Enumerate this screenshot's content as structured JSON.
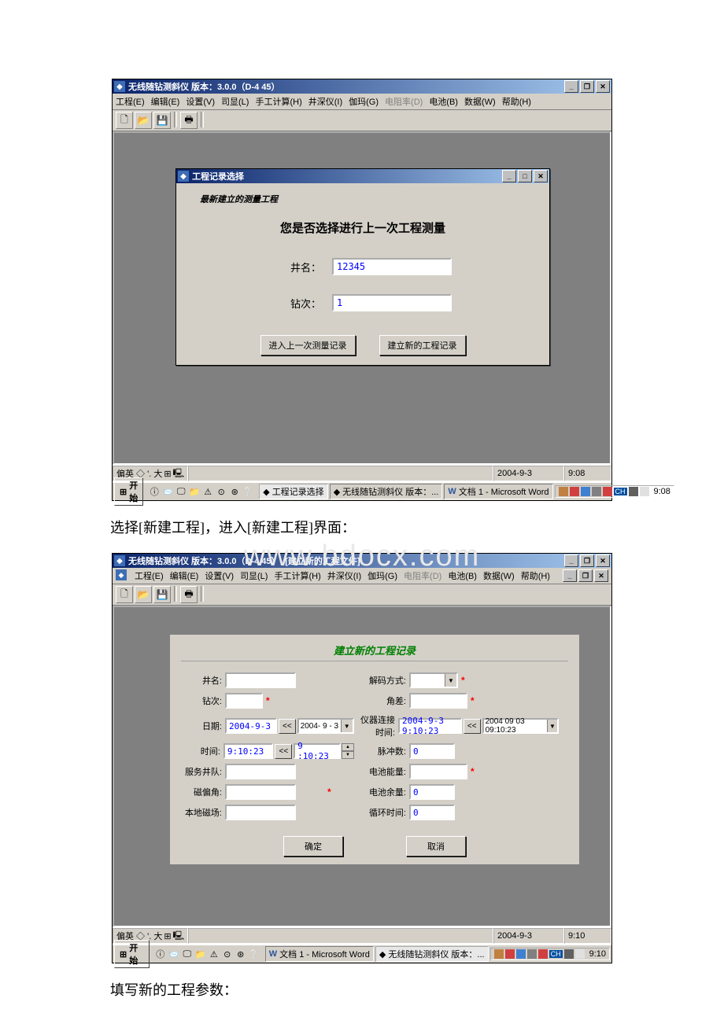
{
  "watermark": "www.bdocx.com",
  "screenshot1": {
    "title": "无线随钻测斜仪 版本：3.0.0（D-4 45）",
    "menubar": [
      {
        "label": "工程(E)",
        "disabled": false
      },
      {
        "label": "编辑(E)",
        "disabled": false
      },
      {
        "label": "设置(V)",
        "disabled": false
      },
      {
        "label": "司显(L)",
        "disabled": false
      },
      {
        "label": "手工计算(H)",
        "disabled": false
      },
      {
        "label": "井深仪(I)",
        "disabled": false
      },
      {
        "label": "伽玛(G)",
        "disabled": false
      },
      {
        "label": "电阻率(D)",
        "disabled": true
      },
      {
        "label": "电池(B)",
        "disabled": false
      },
      {
        "label": "数据(W)",
        "disabled": false
      },
      {
        "label": "帮助(H)",
        "disabled": false
      }
    ],
    "dialog": {
      "title": "工程记录选择",
      "group_label": "最新建立的测量工程",
      "prompt": "您是否选择进行上一次工程测量",
      "well_label": "井名：",
      "well_value": "12345",
      "run_label": "钻次：",
      "run_value": "1",
      "btn_prev": "进入上一次测量记录",
      "btn_new": "建立新的工程记录"
    },
    "status": {
      "left": "偏英 ◇ '. 大",
      "date": "2004-9-3",
      "time": "9:08"
    },
    "taskbar": {
      "start": "开始",
      "tasks": [
        {
          "label": "工程记录选择",
          "active": true
        },
        {
          "label": "无线随钻测斜仪 版本：...",
          "active": false
        },
        {
          "label": "文档 1 - Microsoft Word",
          "active": false
        }
      ],
      "tray_time": "9:08"
    }
  },
  "caption1": "选择[新建工程]，进入[新建工程]界面：",
  "screenshot2": {
    "title": "无线随钻测斜仪 版本：3.0.0（D-4 45）- [建立新的工程文件]",
    "menubar": [
      {
        "label": "工程(E)",
        "disabled": false
      },
      {
        "label": "编辑(E)",
        "disabled": false
      },
      {
        "label": "设置(V)",
        "disabled": false
      },
      {
        "label": "司显(L)",
        "disabled": false
      },
      {
        "label": "手工计算(H)",
        "disabled": false
      },
      {
        "label": "井深仪(I)",
        "disabled": false
      },
      {
        "label": "伽玛(G)",
        "disabled": false
      },
      {
        "label": "电阻率(D)",
        "disabled": true
      },
      {
        "label": "电池(B)",
        "disabled": false
      },
      {
        "label": "数据(W)",
        "disabled": false
      },
      {
        "label": "帮助(H)",
        "disabled": false
      }
    ],
    "child_win_controls": true,
    "form": {
      "title": "建立新的工程记录",
      "left_fields": {
        "well_name": {
          "label": "井名:",
          "value": ""
        },
        "run": {
          "label": "钻次:",
          "value": "",
          "required": true
        },
        "date": {
          "label": "日期:",
          "value": "2004-9-3",
          "picker": "2004- 9 - 3"
        },
        "time": {
          "label": "时间:",
          "value": "9:10:23",
          "picker": "9 :10:23"
        },
        "service": {
          "label": "服务井队:",
          "value": ""
        },
        "mag_dec": {
          "label": "磁偏角:",
          "value": "",
          "required": true
        },
        "local_mag": {
          "label": "本地磁场:",
          "value": ""
        }
      },
      "right_fields": {
        "decode": {
          "label": "解码方式:",
          "value": "",
          "required": true
        },
        "angle_diff": {
          "label": "角差:",
          "value": "",
          "required": true
        },
        "conn_time": {
          "label": "仪器连接时间:",
          "value": "2004-9-3 9:10:23",
          "picker": "2004 09 03 09:10:23"
        },
        "pulse": {
          "label": "脉冲数:",
          "value": "0"
        },
        "battery_cap": {
          "label": "电池能量:",
          "value": "",
          "required": true
        },
        "battery_rem": {
          "label": "电池余量:",
          "value": "0"
        },
        "cycle": {
          "label": "循环时间:",
          "value": "0"
        }
      },
      "btn_ok": "确定",
      "btn_cancel": "取消",
      "arrow_btn": "<<"
    },
    "status": {
      "left": "偏英 ◇ '. 大",
      "date": "2004-9-3",
      "time": "9:10"
    },
    "taskbar": {
      "start": "开始",
      "tasks": [
        {
          "label": "文档 1 - Microsoft Word",
          "active": false
        },
        {
          "label": "无线随钻测斜仪 版本：...",
          "active": true
        }
      ],
      "tray_time": "9:10"
    }
  },
  "caption2": "填写新的工程参数："
}
